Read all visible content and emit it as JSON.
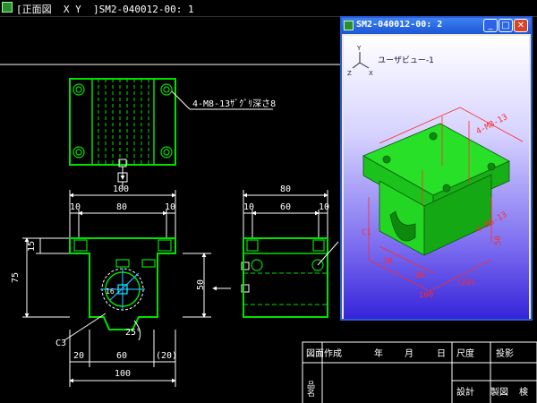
{
  "main_window": {
    "title": "[正面図  X Y  ]SM2-040012-00: 1"
  },
  "sub_window": {
    "title": "SM2-040012-00: 2",
    "view_label": "ユーザビュー-1",
    "buttons": {
      "minimize": "_",
      "maximize": "□",
      "close": "✕"
    },
    "axes": {
      "y": "Y",
      "z": "Z",
      "x": "X"
    },
    "dims": {
      "top": "4-M8-13",
      "c": "C1",
      "d20": "20",
      "d60": "60",
      "d100": "100",
      "d50": "50",
      "d20r": "(20)",
      "chain": "4-M8-13"
    }
  },
  "drawing": {
    "note_holes": "4-M8-13ｻﾞｸﾞﾘ深さ8",
    "top_width": "100",
    "front": {
      "d10a": "10",
      "d80": "80",
      "d10b": "10",
      "d15": "15",
      "d75": "75",
      "c3": "C3",
      "d25": "25°",
      "d20": "20",
      "d60": "60",
      "d20r": "(20)",
      "d100": "100",
      "d16": "16"
    },
    "side": {
      "d80": "80",
      "d10a": "10",
      "d60": "60",
      "d10b": "10",
      "d50": "50"
    }
  },
  "title_block": {
    "created": "図面作成",
    "year": "年",
    "month": "月",
    "day": "日",
    "scale": "尺度",
    "projection": "投影",
    "name": "品名",
    "design": "設計",
    "drafting": "製図",
    "check": "検"
  },
  "colors": {
    "lines": "#ffffff",
    "part": "#00e000",
    "dimension": "#ff2a2a",
    "background": "#000000"
  }
}
